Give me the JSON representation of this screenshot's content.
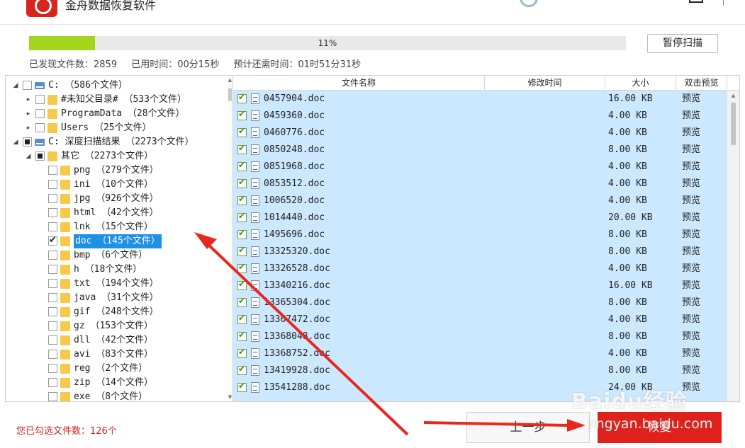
{
  "app": {
    "title": "金舟数据恢复软件"
  },
  "progress": {
    "percent": 11,
    "label": "11%"
  },
  "buttons": {
    "pause": "暂停扫描",
    "prev": "上一步",
    "recover": "恢复"
  },
  "stats": {
    "found": "已发现文件数：2859",
    "elapsed": "已用时间：00分15秒",
    "remaining": "预计还需时间：01时51分31秒"
  },
  "tree": [
    {
      "label": "C:   （586个文件）",
      "kind": "drive",
      "expander": "open",
      "check": "none"
    },
    {
      "label": "#未知父目录#   （533个文件）",
      "kind": "folder",
      "expander": "closed",
      "check": "none"
    },
    {
      "label": "ProgramData   （28个文件）",
      "kind": "folder",
      "expander": "closed",
      "check": "none"
    },
    {
      "label": "Users   （25个文件）",
      "kind": "folder",
      "expander": "closed",
      "check": "none"
    },
    {
      "label": "C: 深度扫描结果   （2273个文件）",
      "kind": "drive",
      "expander": "open",
      "check": "partial"
    },
    {
      "label": "其它   （2273个文件）",
      "kind": "folder",
      "expander": "open",
      "check": "partial"
    },
    {
      "label": "png   （279个文件）",
      "kind": "folder",
      "expander": "",
      "check": "none"
    },
    {
      "label": "ini   （10个文件）",
      "kind": "folder",
      "expander": "",
      "check": "none"
    },
    {
      "label": "jpg   （926个文件）",
      "kind": "folder",
      "expander": "",
      "check": "none"
    },
    {
      "label": "html   （42个文件）",
      "kind": "folder",
      "expander": "",
      "check": "none"
    },
    {
      "label": "lnk   （15个文件）",
      "kind": "folder",
      "expander": "",
      "check": "none"
    },
    {
      "label": "doc   （145个文件）",
      "kind": "folder",
      "expander": "",
      "check": "checked",
      "selected": true
    },
    {
      "label": "bmp   （6个文件）",
      "kind": "folder",
      "expander": "",
      "check": "none"
    },
    {
      "label": "h   （18个文件）",
      "kind": "folder",
      "expander": "",
      "check": "none"
    },
    {
      "label": "txt   （194个文件）",
      "kind": "folder",
      "expander": "",
      "check": "none"
    },
    {
      "label": "java   （31个文件）",
      "kind": "folder",
      "expander": "",
      "check": "none"
    },
    {
      "label": "gif   （248个文件）",
      "kind": "folder",
      "expander": "",
      "check": "none"
    },
    {
      "label": "gz   （153个文件）",
      "kind": "folder",
      "expander": "",
      "check": "none"
    },
    {
      "label": "dll   （42个文件）",
      "kind": "folder",
      "expander": "",
      "check": "none"
    },
    {
      "label": "avi   （83个文件）",
      "kind": "folder",
      "expander": "",
      "check": "none"
    },
    {
      "label": "reg   （2个文件）",
      "kind": "folder",
      "expander": "",
      "check": "none"
    },
    {
      "label": "zip   （14个文件）",
      "kind": "folder",
      "expander": "",
      "check": "none"
    },
    {
      "label": "exe   （8个文件）",
      "kind": "folder",
      "expander": "",
      "check": "none"
    }
  ],
  "table": {
    "headers": [
      "文件名称",
      "修改时间",
      "大小",
      "双击预览"
    ],
    "rows": [
      {
        "name": "0457904.doc",
        "mtime": "",
        "size": "16.00 KB",
        "preview": "预览"
      },
      {
        "name": "0459360.doc",
        "mtime": "",
        "size": "4.00 KB",
        "preview": "预览"
      },
      {
        "name": "0460776.doc",
        "mtime": "",
        "size": "4.00 KB",
        "preview": "预览"
      },
      {
        "name": "0850248.doc",
        "mtime": "",
        "size": "8.00 KB",
        "preview": "预览"
      },
      {
        "name": "0851968.doc",
        "mtime": "",
        "size": "4.00 KB",
        "preview": "预览"
      },
      {
        "name": "0853512.doc",
        "mtime": "",
        "size": "4.00 KB",
        "preview": "预览"
      },
      {
        "name": "1006520.doc",
        "mtime": "",
        "size": "4.00 KB",
        "preview": "预览"
      },
      {
        "name": "1014440.doc",
        "mtime": "",
        "size": "20.00 KB",
        "preview": "预览"
      },
      {
        "name": "1495696.doc",
        "mtime": "",
        "size": "8.00 KB",
        "preview": "预览"
      },
      {
        "name": "13325320.doc",
        "mtime": "",
        "size": "8.00 KB",
        "preview": "预览"
      },
      {
        "name": "13326528.doc",
        "mtime": "",
        "size": "4.00 KB",
        "preview": "预览"
      },
      {
        "name": "13340216.doc",
        "mtime": "",
        "size": "16.00 KB",
        "preview": "预览"
      },
      {
        "name": "13365304.doc",
        "mtime": "",
        "size": "8.00 KB",
        "preview": "预览"
      },
      {
        "name": "13367472.doc",
        "mtime": "",
        "size": "4.00 KB",
        "preview": "预览"
      },
      {
        "name": "13368048.doc",
        "mtime": "",
        "size": "8.00 KB",
        "preview": "预览"
      },
      {
        "name": "13368752.doc",
        "mtime": "",
        "size": "4.00 KB",
        "preview": "预览"
      },
      {
        "name": "13419928.doc",
        "mtime": "",
        "size": "8.00 KB",
        "preview": "预览"
      },
      {
        "name": "13541288.doc",
        "mtime": "",
        "size": "24.00 KB",
        "preview": "预览"
      }
    ]
  },
  "footer": {
    "selected": "您已勾选文件数：126个"
  },
  "watermark": {
    "brand": "Baidu经验",
    "url": "jingyan.baidu.com"
  },
  "colors": {
    "accent": "#e0211b",
    "progress": "#a5d41c",
    "selection": "#1e90e6",
    "rowBg": "#cce8ff",
    "annotation": "#e8281f"
  },
  "icons": {
    "logo": "jinzhou-logo-icon",
    "drive": "drive-icon",
    "folder": "folder-icon",
    "doc": "doc-file-icon"
  }
}
